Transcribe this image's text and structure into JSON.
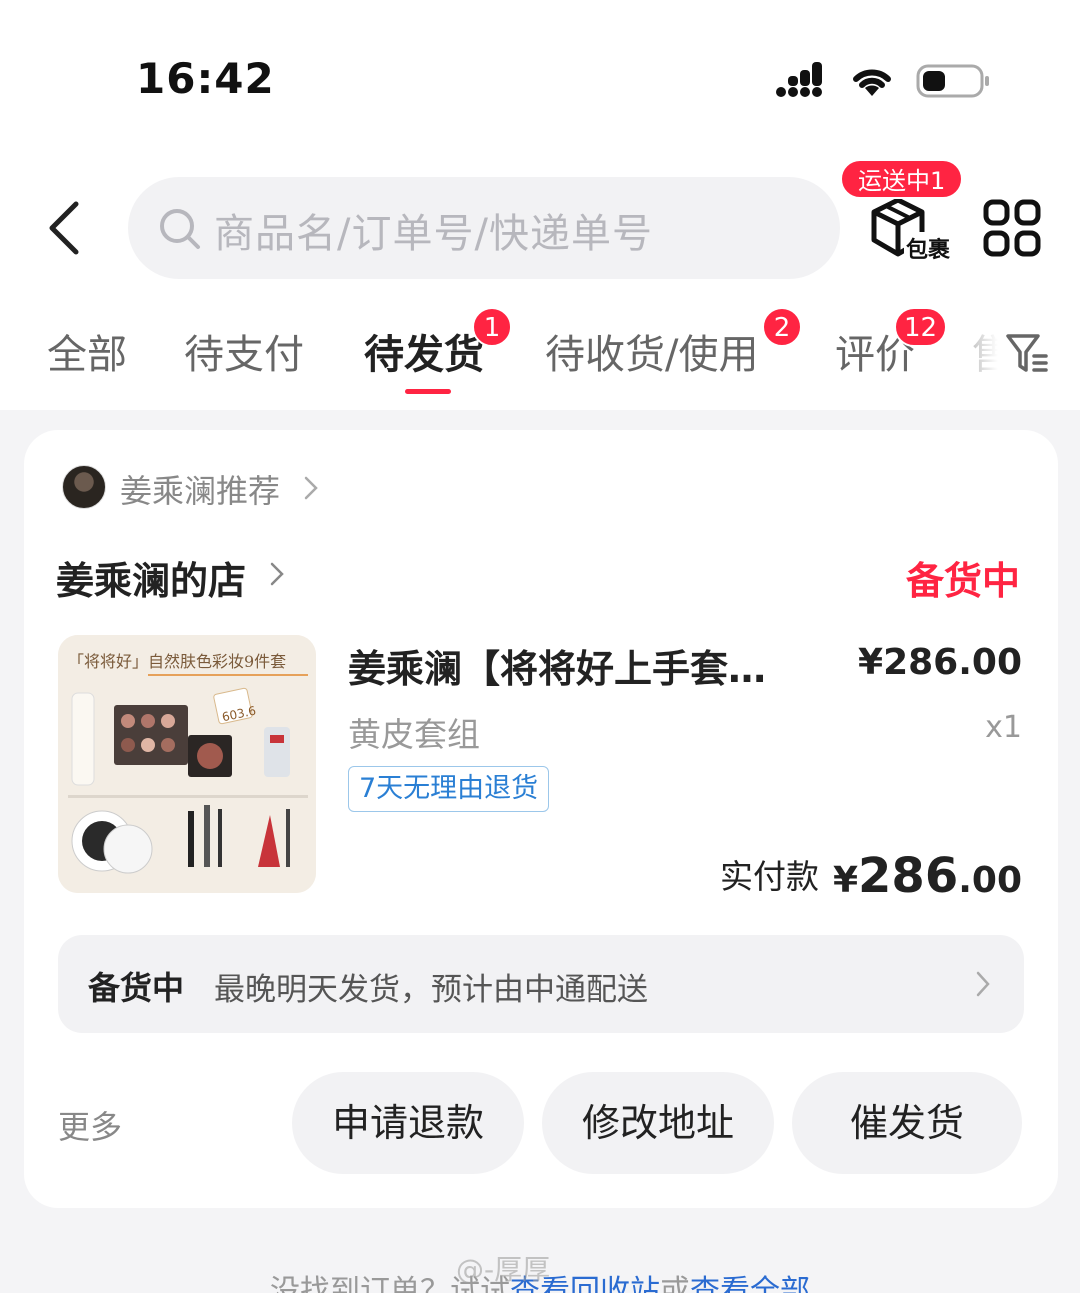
{
  "status_bar": {
    "time": "16:42"
  },
  "header": {
    "search_placeholder": "商品名/订单号/快递单号",
    "package_label": "包裹",
    "shipping_badge": "运送中1"
  },
  "tabs": [
    {
      "label": "全部"
    },
    {
      "label": "待支付"
    },
    {
      "label": "待发货",
      "badge": "1",
      "active": true
    },
    {
      "label": "待收货/使用",
      "badge": "2"
    },
    {
      "label": "评价",
      "badge": "12"
    },
    {
      "label": "售"
    }
  ],
  "order": {
    "recommender": "姜乘澜推荐",
    "shop_name": "姜乘澜的店",
    "status": "备货中",
    "product": {
      "title": "姜乘澜【将将好上手套…",
      "price": "¥286.00",
      "variant": "黄皮套组",
      "quantity": "x1",
      "tag": "7天无理由退货",
      "image_text": {
        "headline": "「将将好」自然肤色彩妆9件套",
        "price_tag": "603.6"
      }
    },
    "paid": {
      "label": "实付款",
      "currency": "¥",
      "integer": "286",
      "decimal": ".00"
    },
    "delivery": {
      "status": "备货中",
      "info": "最晚明天发货，预计由中通配送"
    },
    "actions": {
      "more": "更多",
      "refund": "申请退款",
      "change_address": "修改地址",
      "urge": "催发货"
    }
  },
  "footer": {
    "prefix": "没找到订单？试试",
    "link_recycle": "查看回收站",
    "middle": "或",
    "link_all": "查看全部"
  },
  "watermark": "@-厚厚"
}
